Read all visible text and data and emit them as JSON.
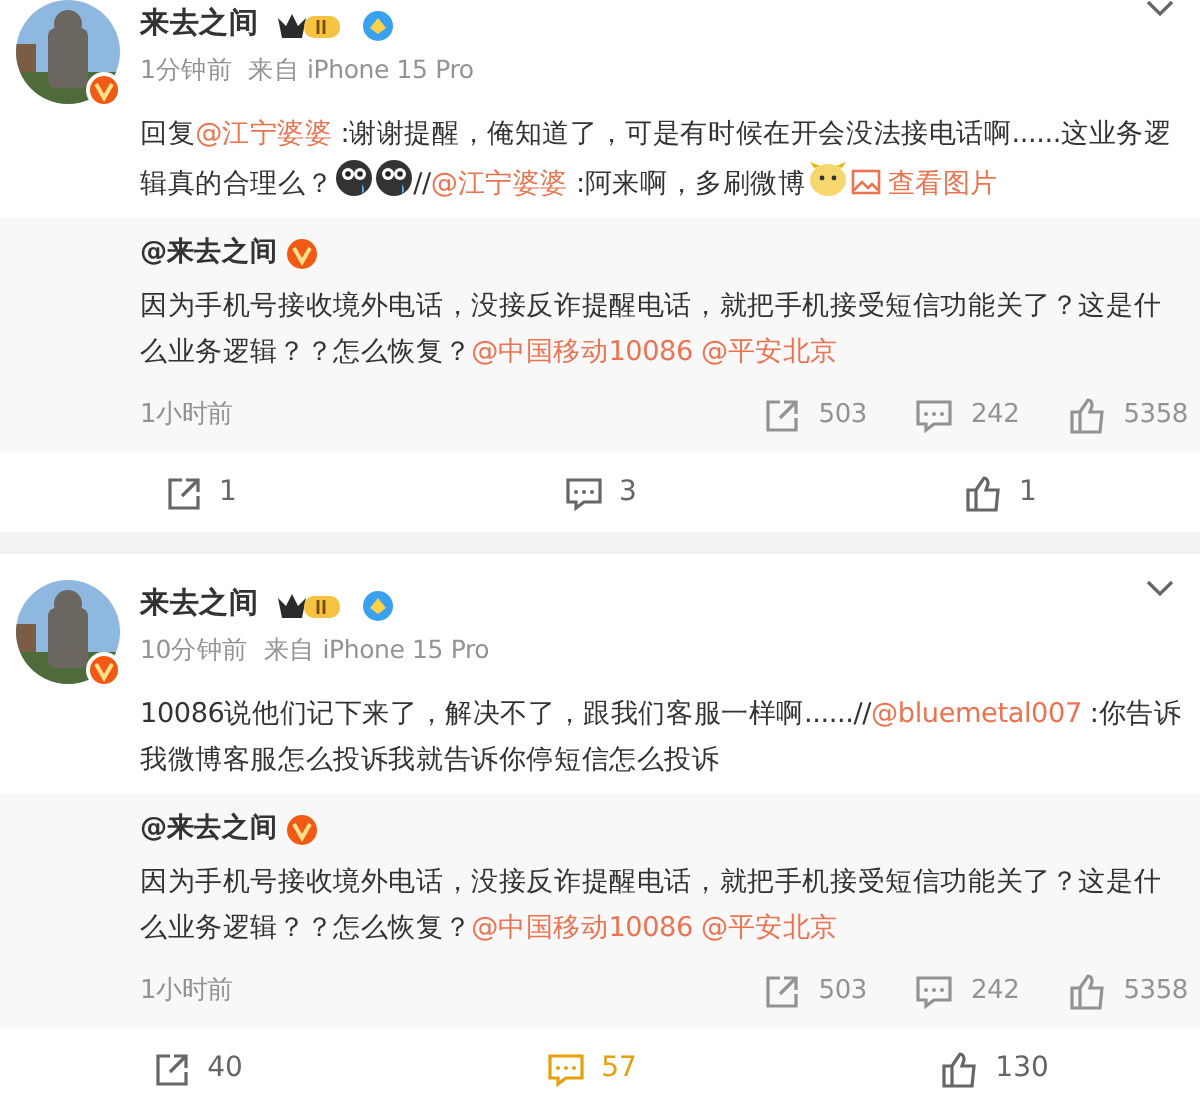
{
  "posts": [
    {
      "author": "来去之间",
      "time": "1分钟前",
      "source": "来自 iPhone 15 Pro",
      "text": [
        {
          "kind": "text",
          "text": "回复"
        },
        {
          "kind": "mention",
          "text": "@江宁婆婆"
        },
        {
          "kind": "text",
          "text": ":谢谢提醒，俺知道了，可是有时候在开会没法接电话啊......这业务逻辑真的合理么？"
        },
        {
          "kind": "emoji"
        },
        {
          "kind": "emoji"
        },
        {
          "kind": "text",
          "text": "//"
        },
        {
          "kind": "mention",
          "text": "@江宁婆婆"
        },
        {
          "kind": "text",
          "text": ":阿来啊，多刷微博"
        },
        {
          "kind": "sticker"
        },
        {
          "kind": "image-link",
          "text": "查看图片"
        }
      ],
      "quote": {
        "author": "@来去之间",
        "text": [
          {
            "kind": "text",
            "text": "因为手机号接收境外电话，没接反诈提醒电话，就把手机接受短信功能关了？这是什么业务逻辑？？怎么恢复？"
          },
          {
            "kind": "mention",
            "text": "@中国移动10086"
          },
          {
            "kind": "mention",
            "text": "@平安北京"
          }
        ],
        "time": "1小时前",
        "reposts": "503",
        "comments": "242",
        "likes": "5358"
      },
      "actions": {
        "reposts": "1",
        "comments": "3",
        "likes": "1",
        "comments_active": false
      }
    },
    {
      "author": "来去之间",
      "time": "10分钟前",
      "source": "来自 iPhone 15 Pro",
      "text": [
        {
          "kind": "text",
          "text": "10086说他们记下来了，解决不了，跟我们客服一样啊......//"
        },
        {
          "kind": "mention",
          "text": "@bluemetal007"
        },
        {
          "kind": "text",
          "text": ":你告诉我微博客服怎么投诉我就告诉你停短信怎么投诉"
        }
      ],
      "quote": {
        "author": "@来去之间",
        "text": [
          {
            "kind": "text",
            "text": "因为手机号接收境外电话，没接反诈提醒电话，就把手机接受短信功能关了？这是什么业务逻辑？？怎么恢复？"
          },
          {
            "kind": "mention",
            "text": "@中国移动10086"
          },
          {
            "kind": "mention",
            "text": "@平安北京"
          }
        ],
        "time": "1小时前",
        "reposts": "503",
        "comments": "242",
        "likes": "5358"
      },
      "actions": {
        "reposts": "40",
        "comments": "57",
        "likes": "130",
        "comments_active": true
      }
    }
  ]
}
